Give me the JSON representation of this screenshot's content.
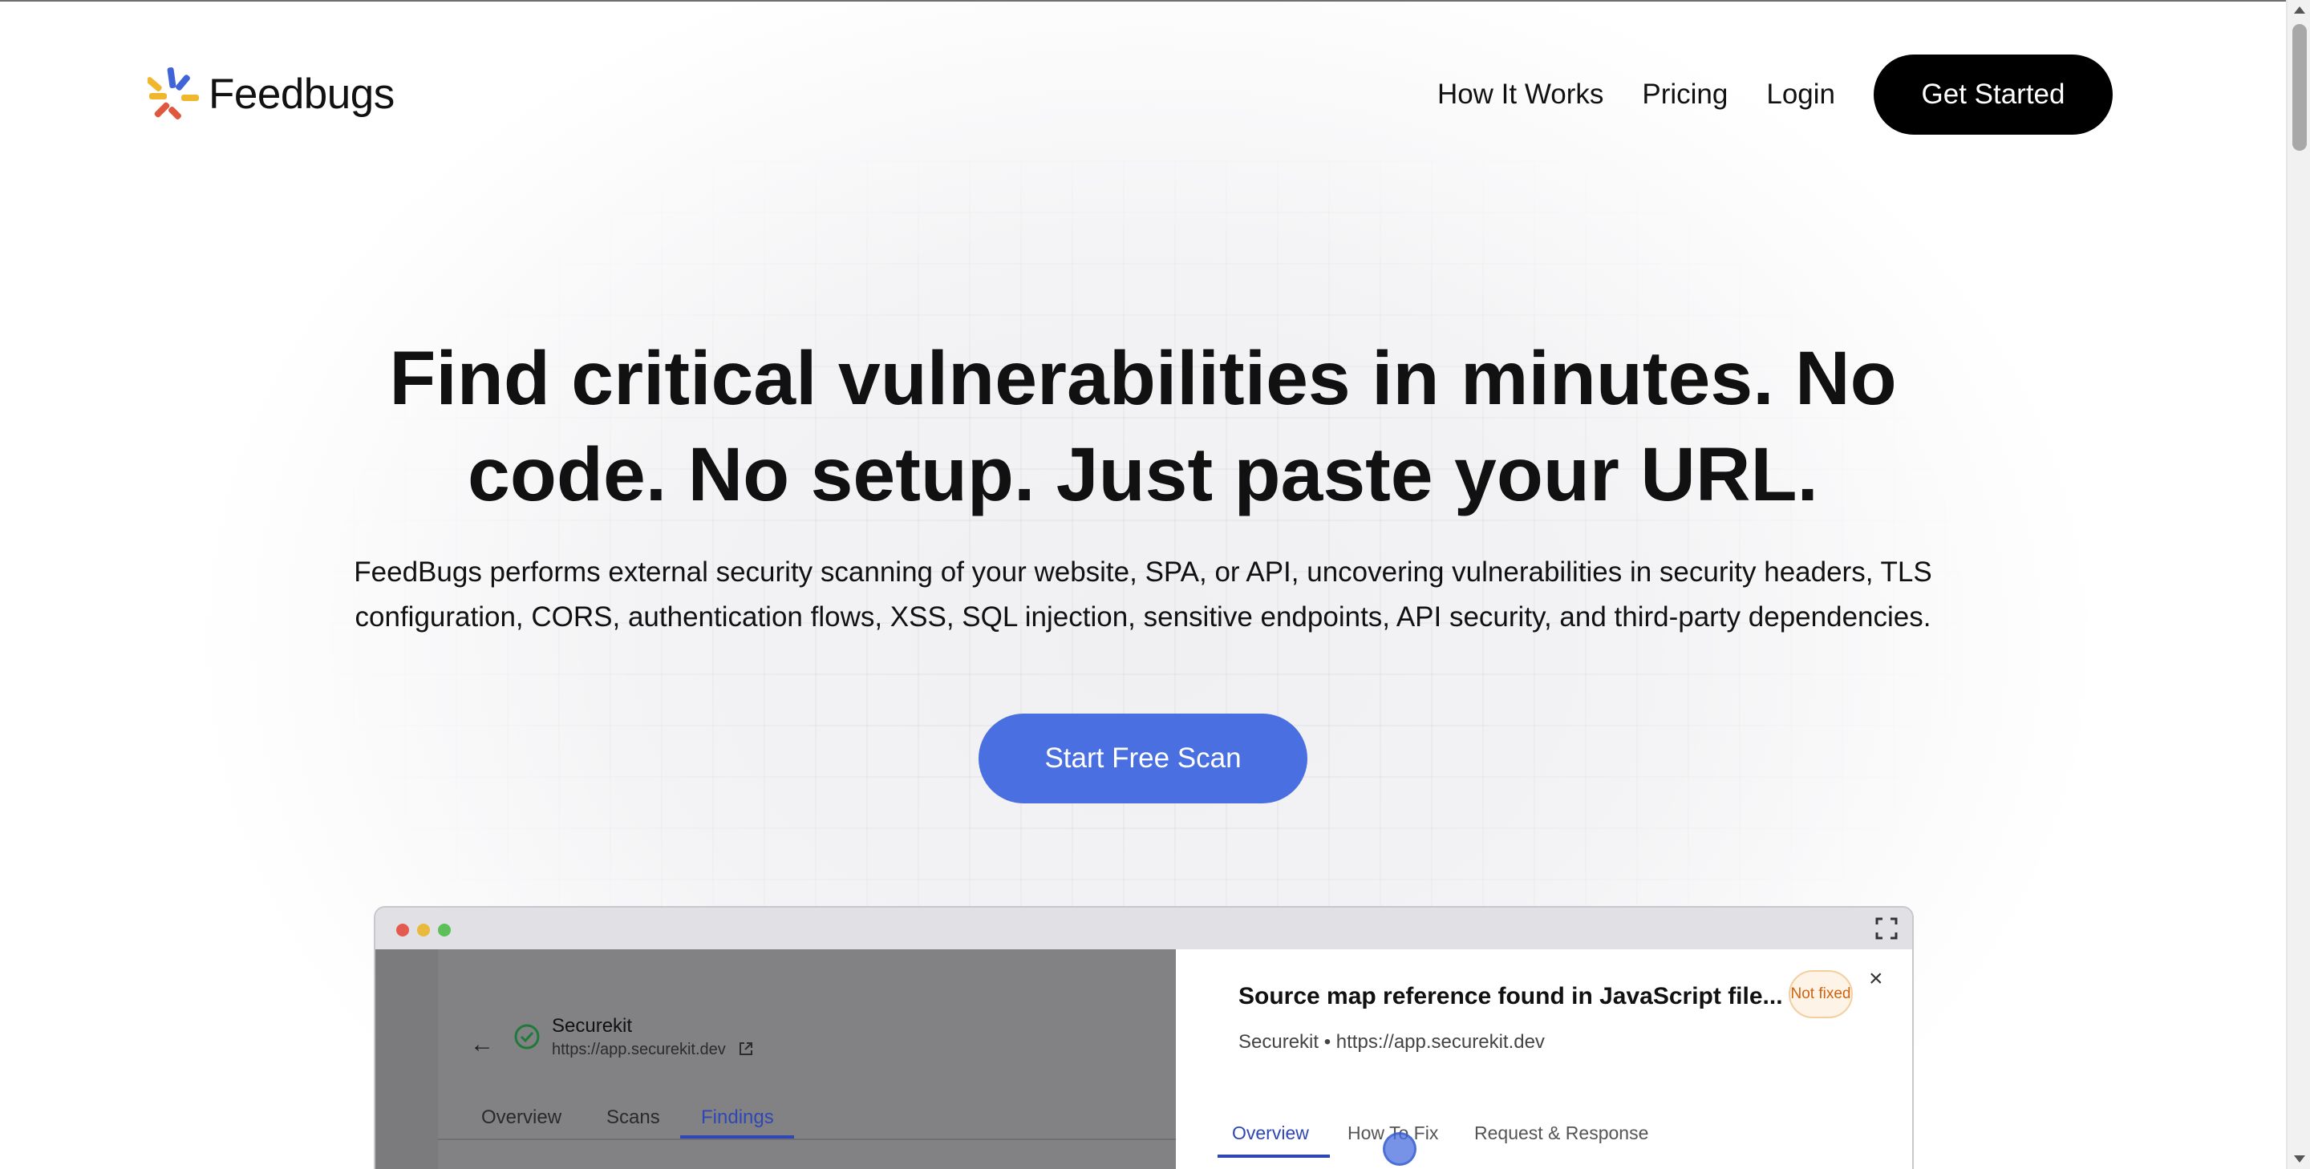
{
  "brand": {
    "name": "Feedbugs"
  },
  "nav": {
    "links": [
      "How It Works",
      "Pricing",
      "Login"
    ],
    "cta": "Get Started"
  },
  "hero": {
    "title_line1": "Find critical vulnerabilities in minutes. No",
    "title_line2": "code. No setup. Just paste your URL.",
    "subtitle_line1": "FeedBugs performs external security scanning of your website, SPA, or API, uncovering vulnerabilities in security headers, TLS",
    "subtitle_line2": "configuration, CORS, authentication flows, XSS, SQL injection, sensitive endpoints, API security, and third-party dependencies.",
    "button": "Start Free Scan"
  },
  "preview": {
    "project": {
      "name": "Securekit",
      "url": "https://app.securekit.dev"
    },
    "left_tabs": [
      "Overview",
      "Scans",
      "Findings"
    ],
    "left_active_tab": "Findings",
    "finding": {
      "title": "Source map reference found in JavaScript file...",
      "status": "Not fixed",
      "meta": "Securekit • https://app.securekit.dev",
      "close": "×"
    },
    "right_tabs": [
      "Overview",
      "How To Fix",
      "Request & Response"
    ],
    "right_active_tab": "Overview"
  },
  "colors": {
    "accent": "#4a6fe0",
    "cta_bg": "#000000",
    "active_tab": "#2f47b4",
    "status_text": "#d0620f",
    "status_bg": "#fdf3e6"
  },
  "icons": [
    "feedbugs-logo-icon",
    "back-arrow-icon",
    "shield-check-icon",
    "external-link-icon",
    "expand-icon",
    "close-icon"
  ]
}
